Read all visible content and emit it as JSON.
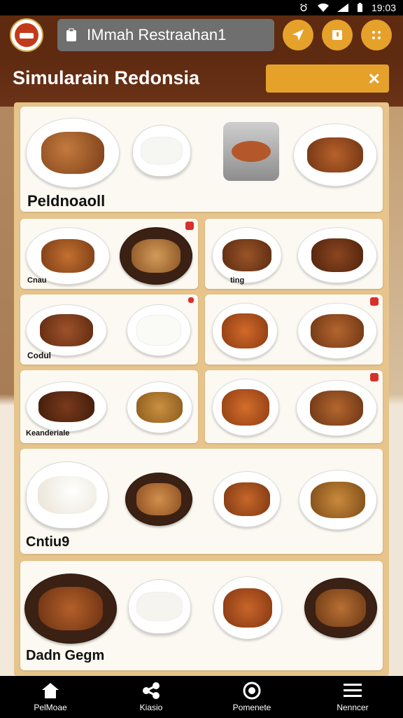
{
  "status": {
    "time": "19:03"
  },
  "header": {
    "search_text": "IMmah Restraahan1"
  },
  "title": {
    "page_title": "Simularain Redonsia",
    "close_symbol": "✕"
  },
  "cards": {
    "c1": "Peldnoaoll",
    "c2": "Cnau",
    "c3": "ting",
    "c4": "Codul",
    "c5": "Keanderiale",
    "c6": "Cntiu9",
    "c7": "Dadn Gegm"
  },
  "nav": {
    "items": [
      {
        "label": "PelMoae"
      },
      {
        "label": "Kiasio"
      },
      {
        "label": "Pomenete"
      },
      {
        "label": "Nenncer"
      }
    ]
  },
  "colors": {
    "header": "#5e2a10",
    "accent": "#e6a12b",
    "panel": "#e7c48b",
    "card": "#fcf9f2"
  }
}
